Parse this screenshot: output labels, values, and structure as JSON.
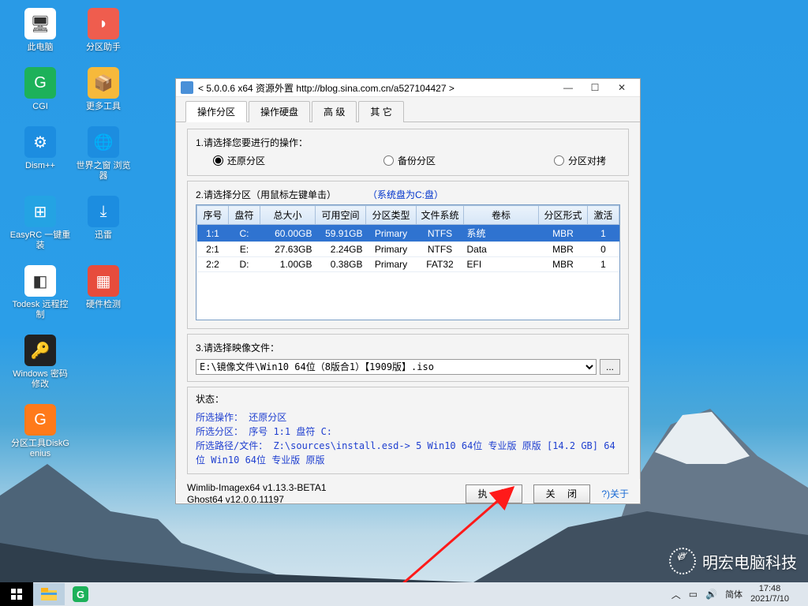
{
  "desktop_icons": [
    {
      "name": "此电脑",
      "color": "#ffffff",
      "glyph": "🖥"
    },
    {
      "name": "分区助手",
      "color": "#ef5d4e",
      "glyph": "◗"
    },
    {
      "name": "CGI",
      "color": "#1db15a",
      "glyph": "G"
    },
    {
      "name": "更多工具",
      "color": "#f6b93b",
      "glyph": "📦"
    },
    {
      "name": "Dism++",
      "color": "#1c8de0",
      "glyph": "⚙"
    },
    {
      "name": "世界之窗 浏览器",
      "color": "#1c8de0",
      "glyph": "🌐"
    },
    {
      "name": "EasyRC 一键重装",
      "color": "#24a3e3",
      "glyph": "⊞"
    },
    {
      "name": "迅雷",
      "color": "#1c8de0",
      "glyph": "⤓"
    },
    {
      "name": "Todesk 远程控制",
      "color": "#ffffff",
      "glyph": "◧"
    },
    {
      "name": "硬件检测",
      "color": "#e74c3c",
      "glyph": "▦"
    },
    {
      "name": "Windows 密码修改",
      "color": "#222222",
      "glyph": "🔑"
    },
    {
      "name": "",
      "color": "transparent",
      "glyph": ""
    },
    {
      "name": "分区工具DiskGenius",
      "color": "#ff7a1a",
      "glyph": "G"
    }
  ],
  "window": {
    "title": "< 5.0.0.6 x64 资源外置 http://blog.sina.com.cn/a527104427 >",
    "tabs": [
      "操作分区",
      "操作硬盘",
      "高 级",
      "其 它"
    ],
    "tab_sel": 0,
    "step1_label": "1.请选择您要进行的操作：",
    "radios": [
      "还原分区",
      "备份分区",
      "分区对拷"
    ],
    "radio_sel": 0,
    "step2_label": "2.请选择分区（用鼠标左键单击）",
    "step2_hint": "（系统盘为C:盘）",
    "cols": [
      "序号",
      "盘符",
      "总大小",
      "可用空间",
      "分区类型",
      "文件系统",
      "卷标",
      "分区形式",
      "激活"
    ],
    "rows": [
      {
        "c": [
          "1:1",
          "C:",
          "60.00GB",
          "59.91GB",
          "Primary",
          "NTFS",
          "系统",
          "MBR",
          "1"
        ],
        "sel": true
      },
      {
        "c": [
          "2:1",
          "E:",
          "27.63GB",
          "2.24GB",
          "Primary",
          "NTFS",
          "Data",
          "MBR",
          "0"
        ],
        "sel": false
      },
      {
        "c": [
          "2:2",
          "D:",
          "1.00GB",
          "0.38GB",
          "Primary",
          "FAT32",
          "EFI",
          "MBR",
          "1"
        ],
        "sel": false
      }
    ],
    "step3_label": "3.请选择映像文件：",
    "path": "E:\\镜像文件\\Win10 64位（8版合1）【1909版】.iso",
    "status_label": "状态：",
    "status_lines": [
      "所选操作： 还原分区",
      "所选分区：  序号 1:1       盘符 C:",
      "所选路径/文件： Z:\\sources\\install.esd-> 5 Win10 64位 专业版 原版 [14.2 GB] 64位 Win10 64位 专业版 原版"
    ],
    "ver1": "Wimlib-Imagex64 v1.13.3-BETA1",
    "ver2": "Ghost64 v12.0.0.11197",
    "btn_run": "执 行",
    "btn_close": "关 闭",
    "about": "?)关于"
  },
  "taskbar": {
    "ime": "简体",
    "time": "17:48",
    "date": "2021/7/10"
  },
  "watermark": "明宏电脑科技"
}
